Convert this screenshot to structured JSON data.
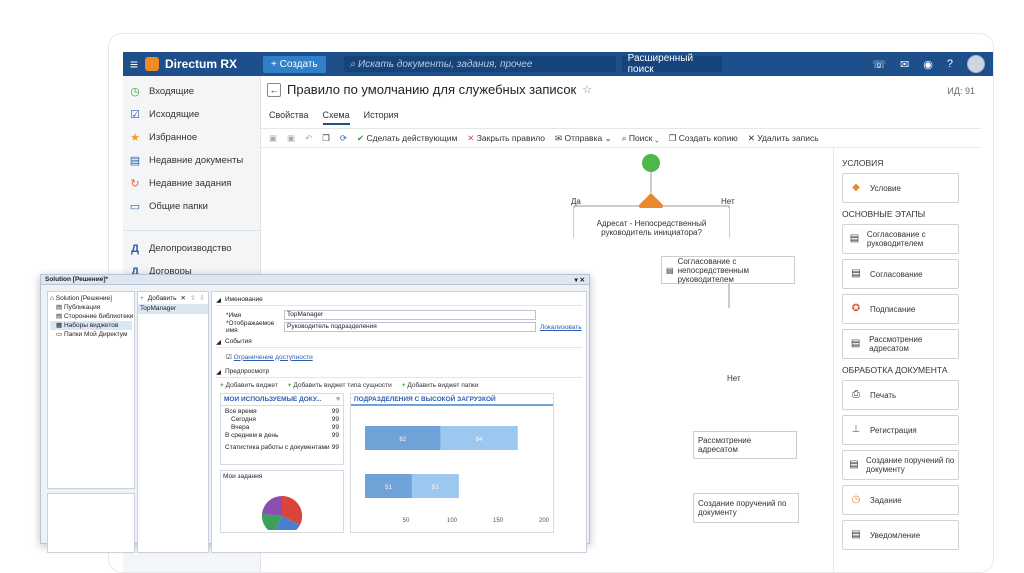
{
  "app": {
    "name": "Directum RX",
    "create_label": "+ Создать",
    "search_placeholder": "Искать документы, задания, прочее",
    "advanced_search": "Расширенный поиск"
  },
  "sidebar": {
    "items": [
      {
        "icon": "clock-icon",
        "label": "Входящие"
      },
      {
        "icon": "check-box-icon",
        "label": "Исходящие"
      },
      {
        "icon": "star-icon",
        "label": "Избранное"
      },
      {
        "icon": "document-icon",
        "label": "Недавние документы"
      },
      {
        "icon": "history-icon",
        "label": "Недавние задания"
      },
      {
        "icon": "folder-icon",
        "label": "Общие папки"
      }
    ],
    "groups": [
      {
        "letter": "Д",
        "label": "Делопроизводство"
      },
      {
        "letter": "Д",
        "label": "Договоры"
      }
    ]
  },
  "page": {
    "title": "Правило по умолчанию для служебных записок",
    "id_label": "ИД: 91",
    "tabs": [
      "Свойства",
      "Схема",
      "История"
    ]
  },
  "toolbar": {
    "make_active": "Сделать действующим",
    "close_rule": "Закрыть правило",
    "send": "Отправка",
    "search": "Поиск",
    "copy": "Создать копию",
    "delete": "Удалить запись"
  },
  "flow": {
    "yes": "Да",
    "no": "Нет",
    "no2": "Нет",
    "condition": "Адресат - Непосредственный руководитель инициатора?",
    "node1": "Согласование с непосредственным руководителем",
    "node2": "Рассмотрение адресатом",
    "node3": "Создание поручений по документу"
  },
  "right": {
    "h_conditions": "УСЛОВИЯ",
    "condition": "Условие",
    "h_stages": "ОСНОВНЫЕ ЭТАПЫ",
    "stages": [
      "Согласование с руководителем",
      "Согласование",
      "Подписание",
      "Рассмотрение адресатом"
    ],
    "h_processing": "ОБРАБОТКА ДОКУМЕНТА",
    "processing": [
      "Печать",
      "Регистрация",
      "Создание поручений по документу",
      "Задание",
      "Уведомление"
    ]
  },
  "solution": {
    "title": "Solution [Решение]*",
    "tree": [
      "Solution [Решение]",
      "Публикация",
      "Сторонние библиотеки",
      "Наборы виджетов",
      "Папки Мой Директум"
    ],
    "add": "Добавить",
    "list_item": "TopManager",
    "sec_naming": "Именование",
    "name_label": "*Имя",
    "name_value": "TopManager",
    "display_label": "*Отображаемое имя",
    "display_value": "Руководитель подразделения",
    "localize": "Локализовать",
    "sec_events": "События",
    "access": "Ограничение доступности",
    "sec_preview": "Предпросмотр",
    "add_widget": "Добавить виджет",
    "add_type_widget": "Добавить виджет типа сущности",
    "add_folder_widget": "Добавить виджет папки",
    "w1_title": "МОИ ИСПОЛЬЗУЕМЫЕ ДОКУ...",
    "w1_rows": [
      [
        "Все время",
        "99"
      ],
      [
        "Сегодня",
        "99"
      ],
      [
        "Вчера",
        "99"
      ],
      [
        "В среднем в день",
        "99"
      ],
      [
        "Статистика работы с документами",
        "99"
      ]
    ],
    "w2_title": "ПОДРАЗДЕЛЕНИЯ С ВЫСОКОЙ ЗАГРУЗКОЙ",
    "w3_title": "Мои задания"
  },
  "chart_data": {
    "type": "bar",
    "orientation": "horizontal",
    "stacked": true,
    "series": [
      {
        "values": [
          82,
          51
        ],
        "color": "#6fa3d8"
      },
      {
        "values": [
          84,
          51
        ],
        "color": "#9cc7ef"
      }
    ],
    "x_ticks": [
      "50",
      "100",
      "150",
      "200"
    ],
    "data_labels": [
      [
        "82",
        "84"
      ],
      [
        "51",
        "51"
      ]
    ]
  }
}
